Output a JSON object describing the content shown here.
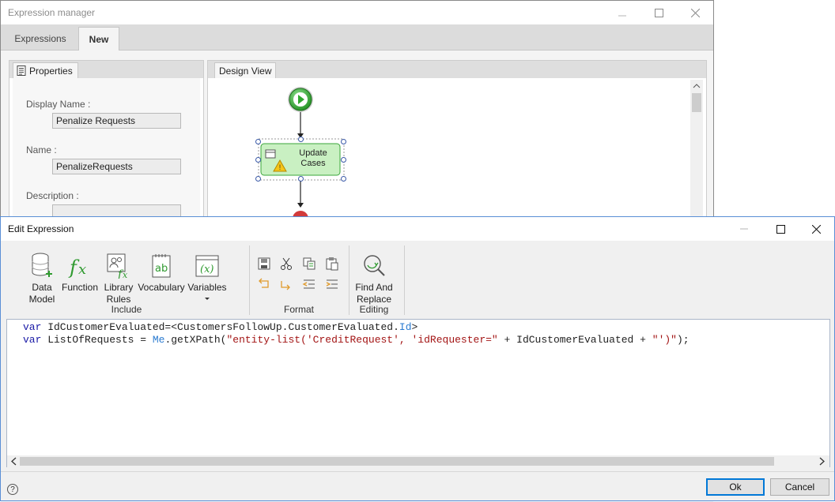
{
  "background_window": {
    "title": "Expression manager",
    "tabs": [
      {
        "label": "Expressions",
        "active": false
      },
      {
        "label": "New",
        "active": true
      }
    ],
    "properties": {
      "tab_label": "Properties",
      "fields": [
        {
          "label": "Display Name :",
          "value": "Penalize Requests"
        },
        {
          "label": "Name :",
          "value": "PenalizeRequests"
        },
        {
          "label": "Description :",
          "value": ""
        }
      ]
    },
    "design_view": {
      "tab_label": "Design View",
      "task_label_line1": "Update",
      "task_label_line2": "Cases"
    }
  },
  "dialog": {
    "title": "Edit Expression",
    "ribbon": {
      "include": {
        "label": "Include",
        "buttons": [
          {
            "label": "Data\nModel",
            "icon": "database-icon"
          },
          {
            "label": "Function",
            "icon": "function-fx-icon"
          },
          {
            "label": "Library\nRules",
            "icon": "library-rules-icon"
          },
          {
            "label": "Vocabulary",
            "icon": "vocabulary-icon"
          },
          {
            "label": "Variables",
            "icon": "variables-icon"
          }
        ]
      },
      "format": {
        "label": "Format"
      },
      "editing": {
        "label": "Editing",
        "buttons": [
          {
            "label": "Find And\nReplace",
            "icon": "find-replace-icon"
          }
        ]
      }
    },
    "code": {
      "line1": {
        "kw": "var",
        "text": " IdCustomerEvaluated=<CustomersFollowUp.CustomerEvaluated.",
        "member": "Id",
        "end": ">"
      },
      "line2": {
        "kw": "var",
        "text1": " ListOfRequests = ",
        "member": "Me",
        "text2": ".getXPath(",
        "string1": "\"entity-list('CreditRequest', 'idRequester=\"",
        "text3": " + IdCustomerEvaluated + ",
        "string2": "\"')\"",
        "text4": ");"
      }
    },
    "ok_label": "Ok",
    "cancel_label": "Cancel",
    "help_glyph": "?"
  },
  "colors": {
    "accent": "#0078d7",
    "start_node": "#2fa82f",
    "task_fill": "#c9f0c2",
    "code_keyword": "#1a1aa6",
    "code_string": "#a31515"
  }
}
